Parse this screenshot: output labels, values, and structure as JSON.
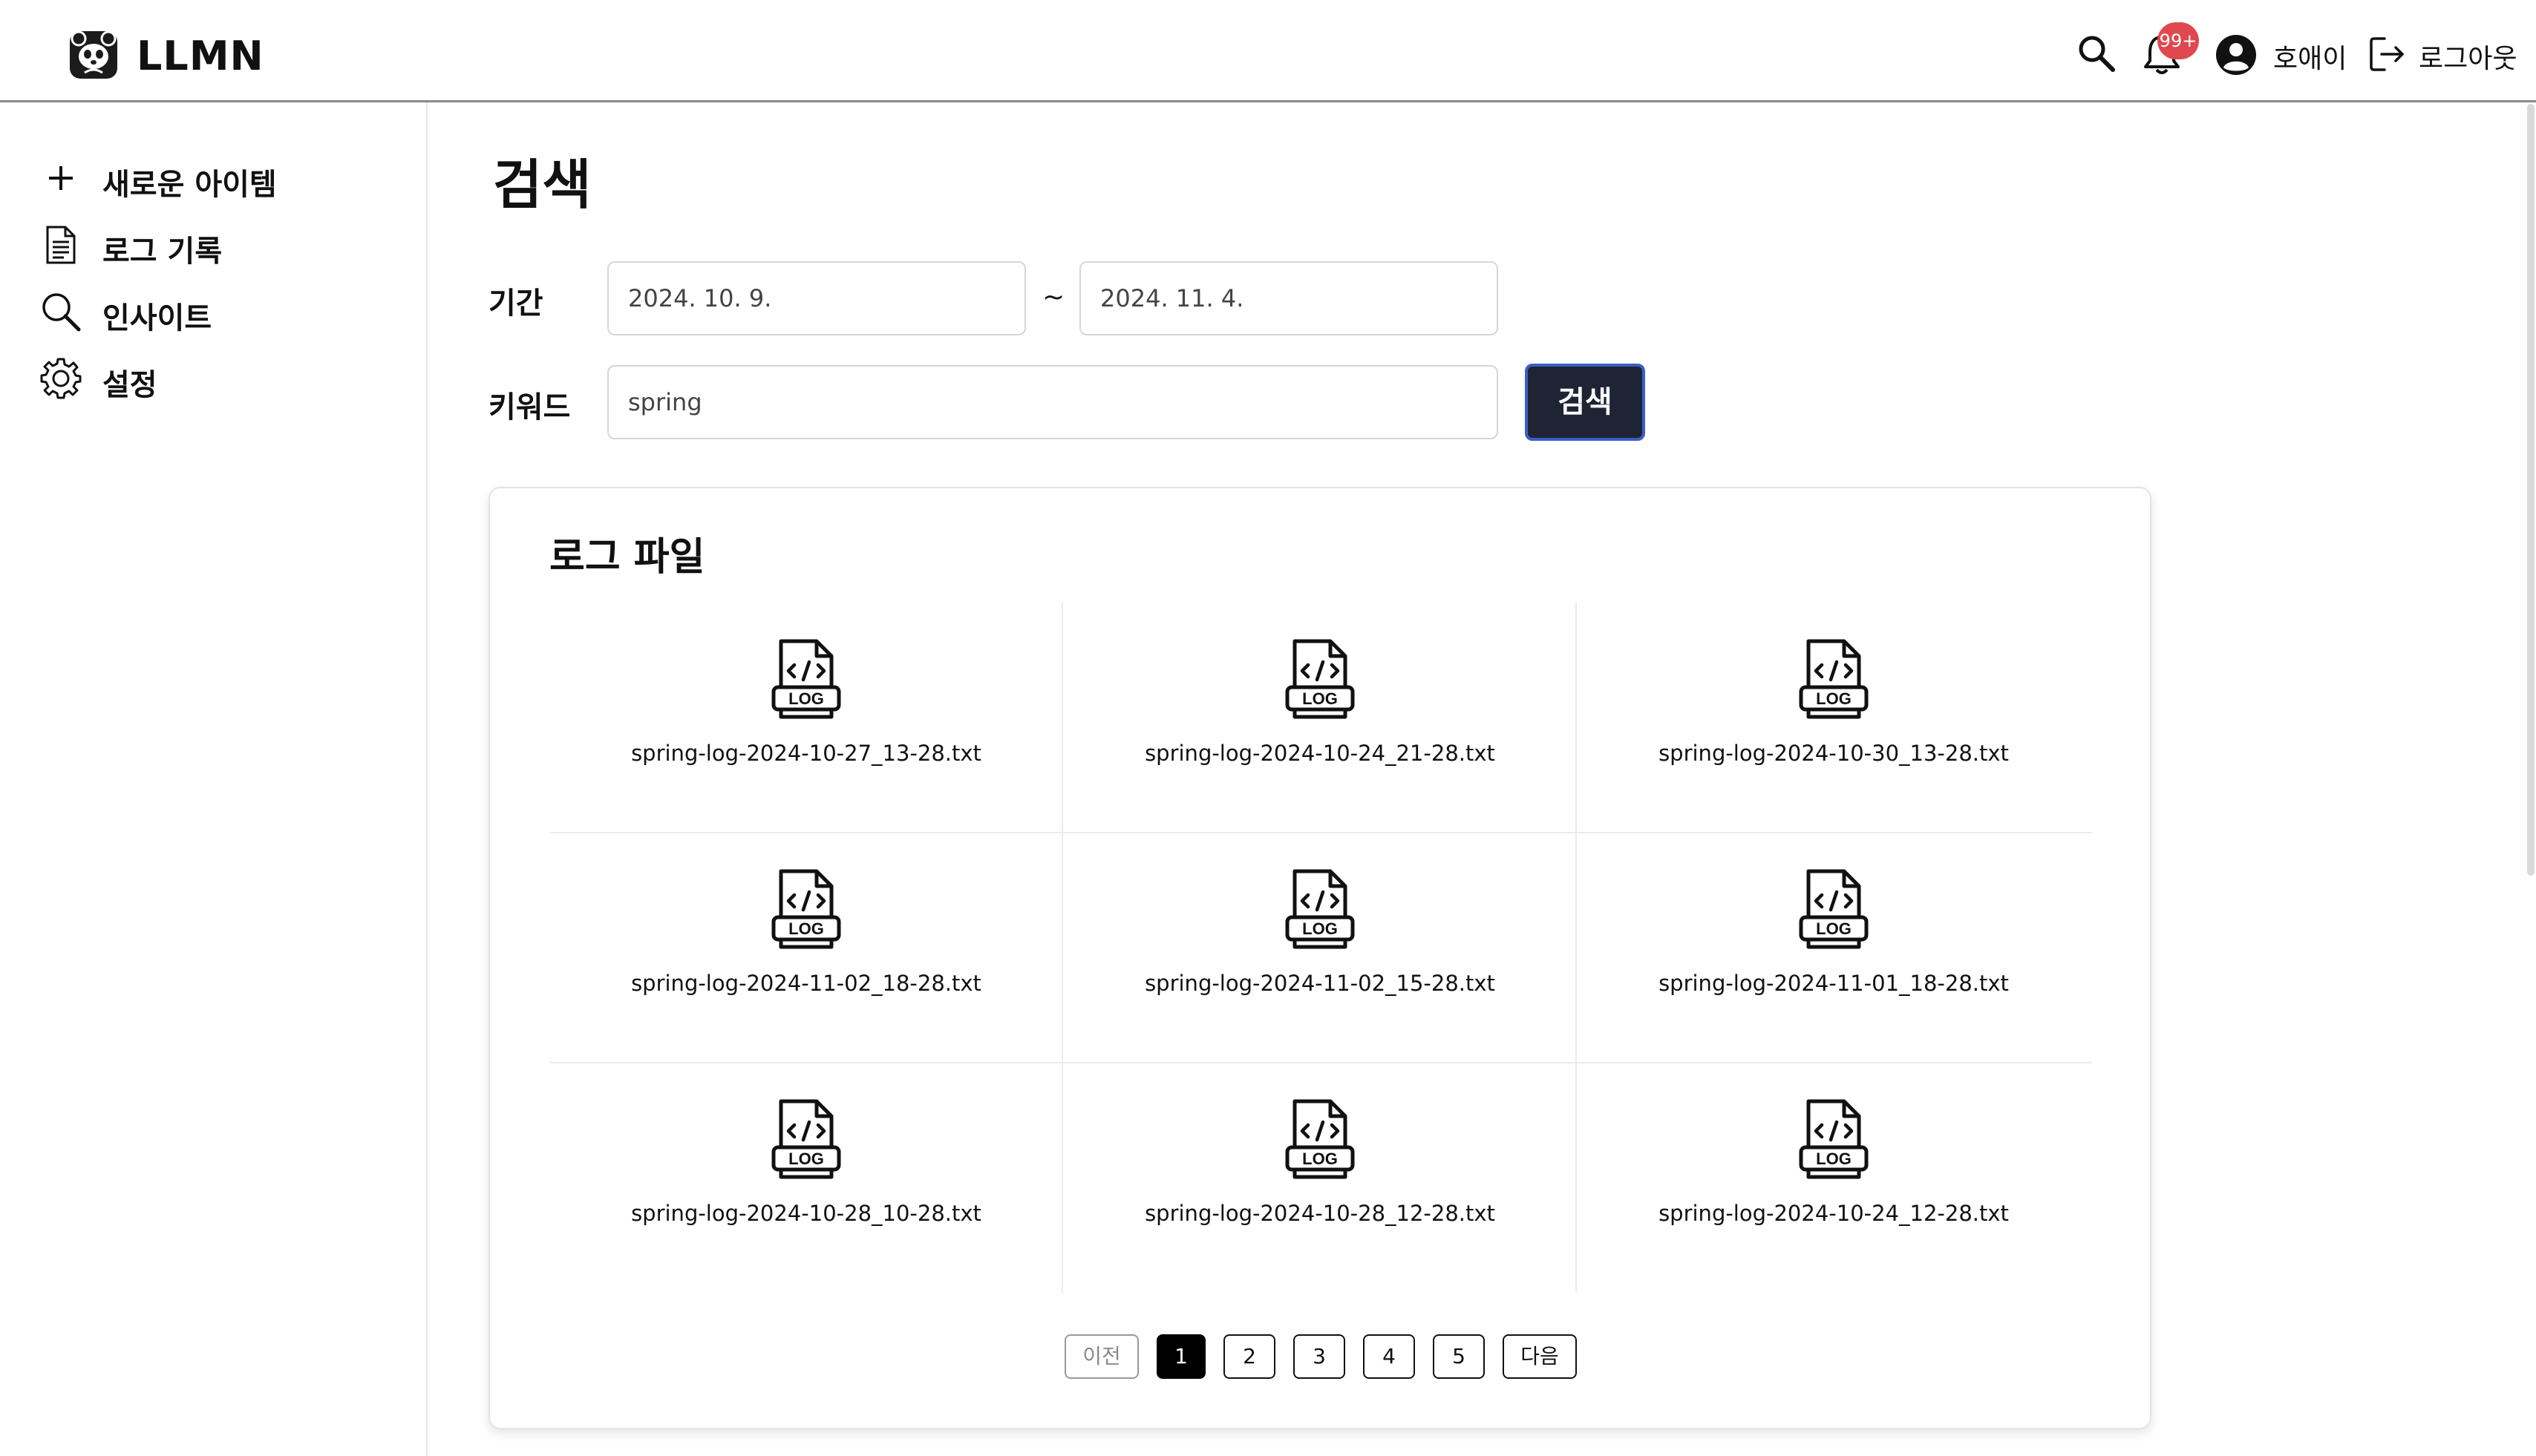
{
  "app": {
    "brand": "LLMN",
    "logo_icon": "panda-logo-icon"
  },
  "header": {
    "search_icon": "search-icon",
    "notification_icon": "bell-icon",
    "notification_badge": "99+",
    "user_icon": "user-icon",
    "user_name": "호애이",
    "logout_icon": "logout-icon",
    "logout_label": "로그아웃"
  },
  "sidebar": {
    "items": [
      {
        "label": "새로운 아이템",
        "icon": "plus-icon"
      },
      {
        "label": "로그 기록",
        "icon": "document-icon"
      },
      {
        "label": "인사이트",
        "icon": "magnifier-icon"
      },
      {
        "label": "설정",
        "icon": "gear-icon"
      }
    ]
  },
  "main": {
    "title": "검색",
    "period_label": "기간",
    "date_from": "2024. 10. 9.",
    "date_separator": "~",
    "date_to": "2024. 11. 4.",
    "keyword_label": "키워드",
    "keyword_value": "spring",
    "search_button": "검색"
  },
  "log_files": {
    "title": "로그 파일",
    "file_icon": "log-file-icon",
    "icon_text": "LOG",
    "files": [
      "spring-log-2024-10-27_13-28.txt",
      "spring-log-2024-10-24_21-28.txt",
      "spring-log-2024-10-30_13-28.txt",
      "spring-log-2024-11-02_18-28.txt",
      "spring-log-2024-11-02_15-28.txt",
      "spring-log-2024-11-01_18-28.txt",
      "spring-log-2024-10-28_10-28.txt",
      "spring-log-2024-10-28_12-28.txt",
      "spring-log-2024-10-24_12-28.txt"
    ]
  },
  "pagination": {
    "prev": "이전",
    "pages": [
      "1",
      "2",
      "3",
      "4",
      "5"
    ],
    "current": "1",
    "next": "다음"
  }
}
